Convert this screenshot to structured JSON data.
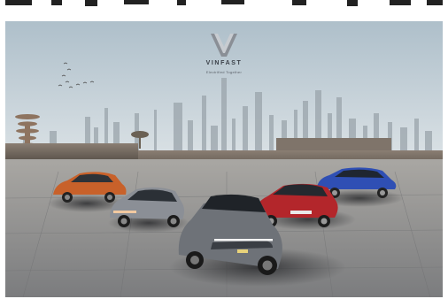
{
  "brand": {
    "name": "VINFAST",
    "tagline": "Electrified Together",
    "logo_icon": "vinfast-v-logo-icon"
  },
  "colors": {
    "sky_top": "#b8c6cf",
    "sky_bottom": "#e7ecee",
    "ground": "#8e8f91",
    "orange_car": "#c8612a",
    "silver_car": "#8b8f96",
    "gray_car": "#6e7278",
    "red_car": "#b3262b",
    "blue_car": "#2f4fb4"
  }
}
